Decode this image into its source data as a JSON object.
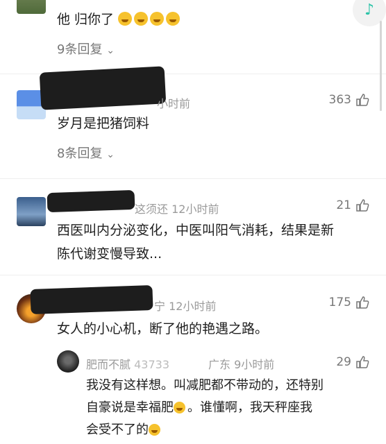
{
  "comments": [
    {
      "text": "他  归你了",
      "emoji_count": 4,
      "replies": "9条回复"
    },
    {
      "time": "小时前",
      "likes": "363",
      "text": "岁月是把猪饲料",
      "replies": "8条回复"
    },
    {
      "name_partial": "这须还",
      "time": "12小时前",
      "likes": "21",
      "text_line1": "西医叫内分泌变化，中医叫阳气消耗，结果是新",
      "text_line2": "陈代谢变慢导致..."
    },
    {
      "location": "宁",
      "time": "12小时前",
      "likes": "175",
      "text": "女人的小心机，断了他的艳遇之路。"
    }
  ],
  "reply": {
    "name": "肥而不腻",
    "name_digits": "43733",
    "location": "广东",
    "time": "9小时前",
    "likes": "29",
    "line1": "我没有这样想。叫减肥都不带动的，还特别",
    "line2_a": "自豪说是幸福肥",
    "line2_b": "。谁懂啊，我天秤座我",
    "line3": "会受不了的"
  },
  "icons": {
    "like": "thumbs-up-icon",
    "chevron": "chevron-down-icon",
    "music": "music-note-icon"
  },
  "colors": {
    "accent": "#2dc3a8",
    "redaction": "#1d1d1d"
  }
}
